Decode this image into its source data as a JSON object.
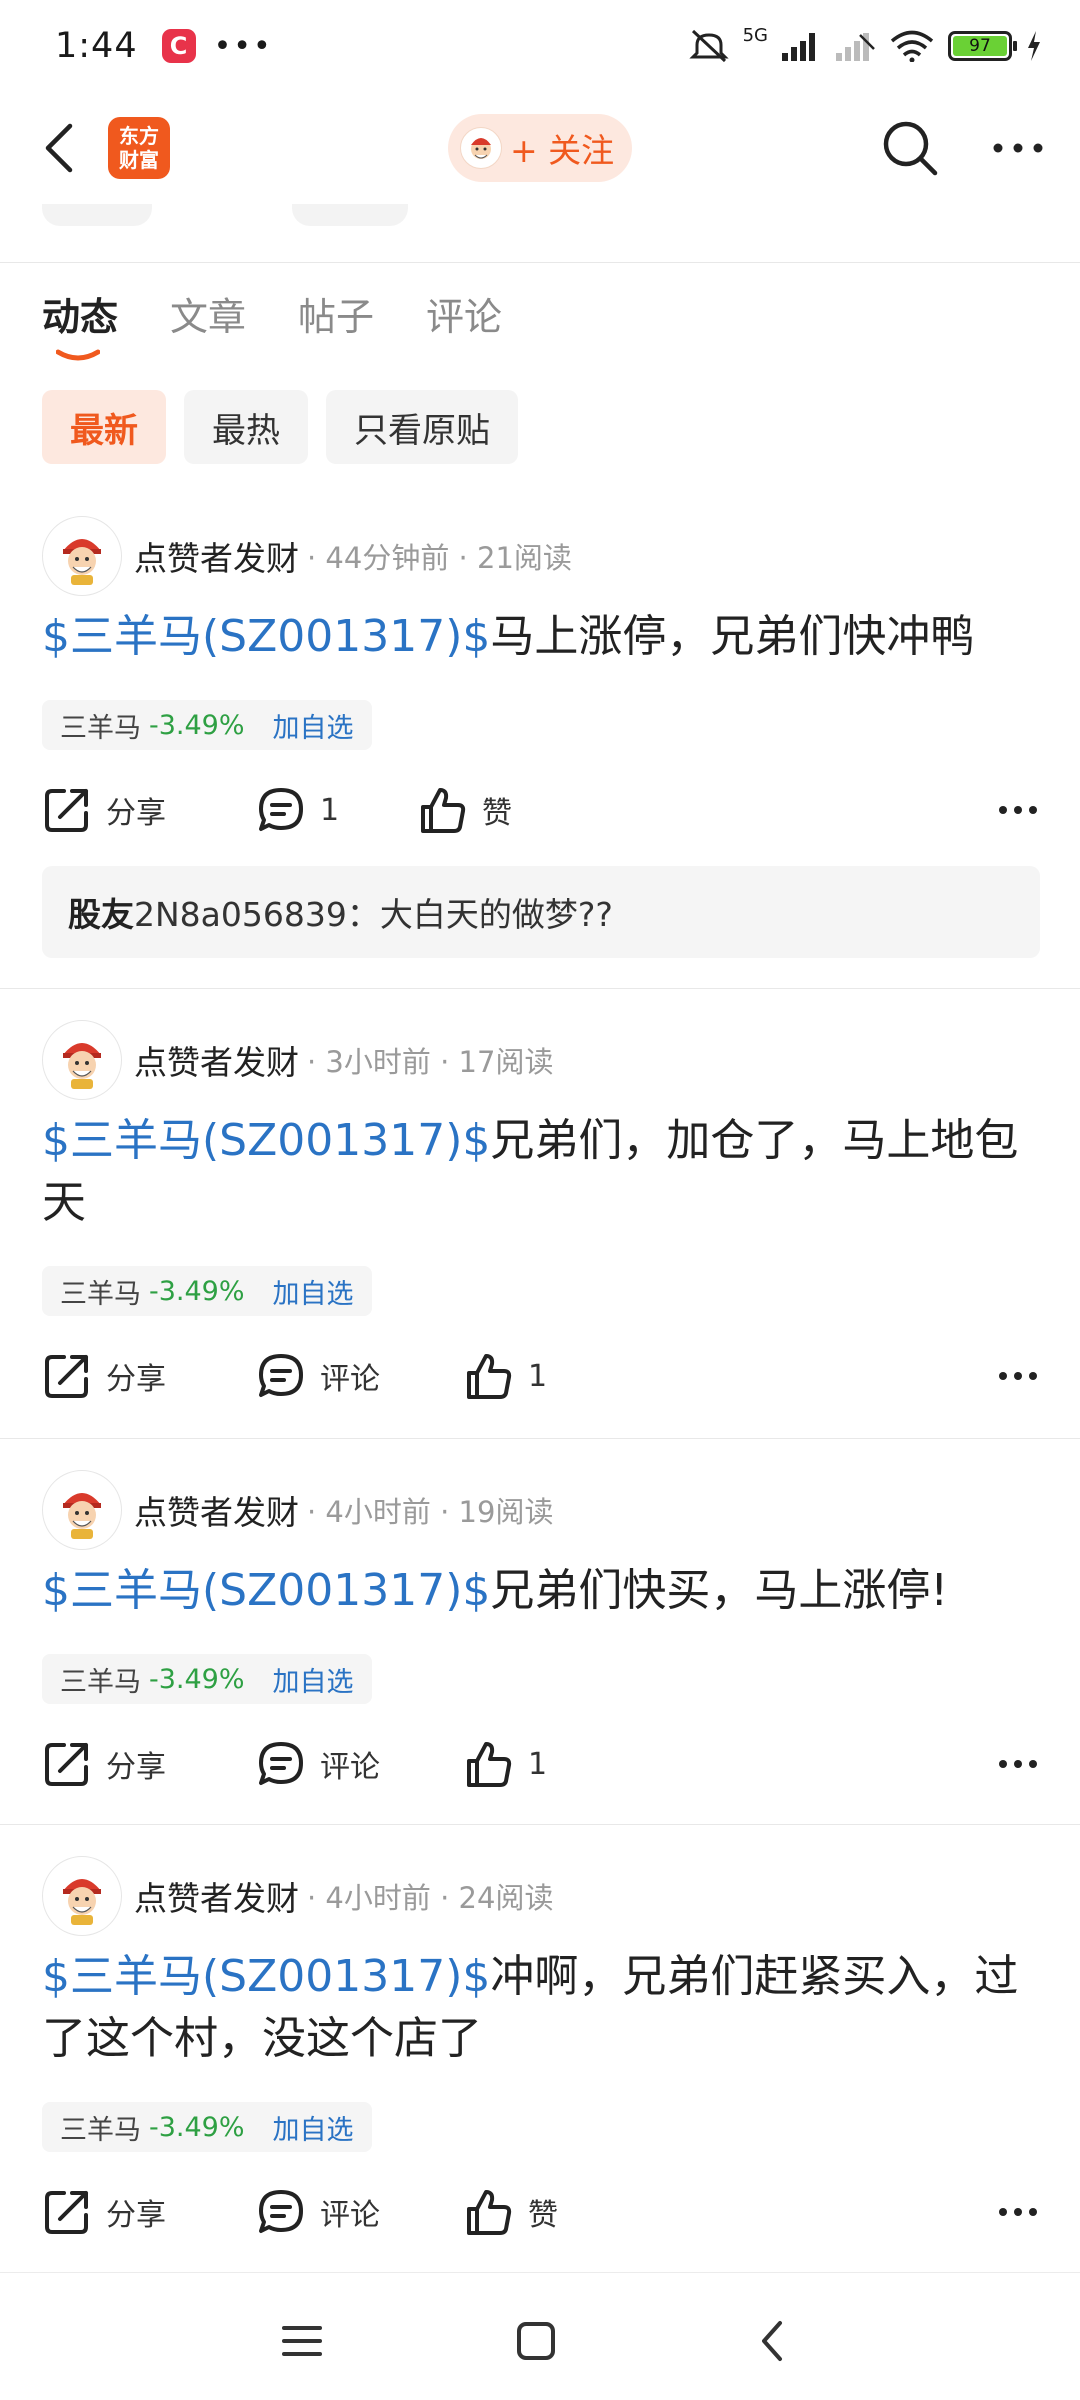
{
  "status_bar": {
    "time": "1:44",
    "app_badge": "C",
    "dots": "•••",
    "network": "5G",
    "battery": "97"
  },
  "nav": {
    "logo_text": "东方财富",
    "follow_label": "+ 关注"
  },
  "tabs": [
    {
      "label": "动态",
      "active": true
    },
    {
      "label": "文章",
      "active": false
    },
    {
      "label": "帖子",
      "active": false
    },
    {
      "label": "评论",
      "active": false
    }
  ],
  "filters": [
    {
      "label": "最新",
      "active": true
    },
    {
      "label": "最热",
      "active": false
    },
    {
      "label": "只看原贴",
      "active": false
    }
  ],
  "posts": [
    {
      "author": "点赞者发财",
      "meta": " · 44分钟前 · 21阅读",
      "stock_link": "$三羊马(SZ001317)$",
      "text": "马上涨停，兄弟们快冲鸭",
      "tag_name": "三羊马",
      "tag_change": "-3.49%",
      "tag_action": "加自选",
      "share": "分享",
      "comment": "1",
      "like": "赞",
      "reply_user": "股友",
      "reply_text": "2N8a056839：大白天的做梦??"
    },
    {
      "author": "点赞者发财",
      "meta": " · 3小时前 · 17阅读",
      "stock_link": "$三羊马(SZ001317)$",
      "text": "兄弟们，加仓了，马上地包天",
      "tag_name": "三羊马",
      "tag_change": "-3.49%",
      "tag_action": "加自选",
      "share": "分享",
      "comment": "评论",
      "like": "1"
    },
    {
      "author": "点赞者发财",
      "meta": " · 4小时前 · 19阅读",
      "stock_link": "$三羊马(SZ001317)$",
      "text": "兄弟们快买，马上涨停!",
      "tag_name": "三羊马",
      "tag_change": "-3.49%",
      "tag_action": "加自选",
      "share": "分享",
      "comment": "评论",
      "like": "1"
    },
    {
      "author": "点赞者发财",
      "meta": " · 4小时前 · 24阅读",
      "stock_link": "$三羊马(SZ001317)$",
      "text": "冲啊，兄弟们赶紧买入，过了这个村，没这个店了",
      "tag_name": "三羊马",
      "tag_change": "-3.49%",
      "tag_action": "加自选",
      "share": "分享",
      "comment": "评论",
      "like": "赞"
    }
  ],
  "colors": {
    "accent": "#f0591e",
    "link": "#2a73c4",
    "down": "#2ea043"
  }
}
